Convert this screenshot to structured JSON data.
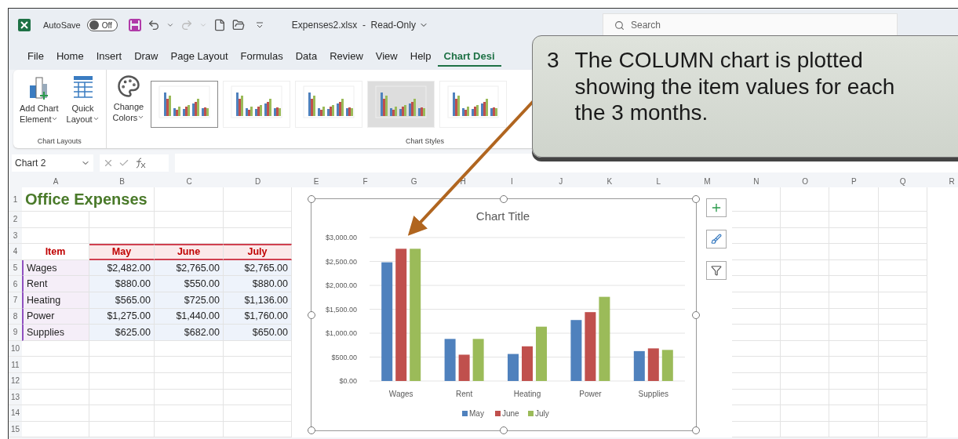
{
  "title_bar": {
    "autosave_label": "AutoSave",
    "autosave_toggle": {
      "on": false,
      "label": "Off"
    },
    "file_name": "Expenses2.xlsx  -  Read-Only",
    "search": {
      "placeholder": "Search"
    }
  },
  "menu_tabs": [
    {
      "label": "File",
      "selected": false
    },
    {
      "label": "Home",
      "selected": false
    },
    {
      "label": "Insert",
      "selected": false
    },
    {
      "label": "Draw",
      "selected": false
    },
    {
      "label": "Page Layout",
      "selected": false
    },
    {
      "label": "Formulas",
      "selected": false
    },
    {
      "label": "Data",
      "selected": false
    },
    {
      "label": "Review",
      "selected": false
    },
    {
      "label": "View",
      "selected": false
    },
    {
      "label": "Help",
      "selected": false
    },
    {
      "label": "Chart Desi",
      "selected": true
    }
  ],
  "ribbon": {
    "chart_layouts": {
      "label": "Chart Layouts",
      "buttons": [
        {
          "kind": "add",
          "lines": [
            "Add Chart",
            "Element"
          ]
        },
        {
          "kind": "layout",
          "lines": [
            "Quick",
            "Layout"
          ]
        }
      ]
    },
    "change_colors": {
      "lines": [
        "Change",
        "Colors"
      ]
    },
    "chart_styles": {
      "label": "Chart Styles",
      "styles": [
        {
          "selected": true
        },
        {
          "selected": false
        },
        {
          "selected": false
        },
        {
          "selected": false
        },
        {
          "selected": false
        }
      ]
    }
  },
  "formula_bar": {
    "name_box": "Chart 2"
  },
  "sheet": {
    "columns": [
      "A",
      "B",
      "C",
      "D",
      "E",
      "F",
      "G",
      "H",
      "I",
      "J",
      "K",
      "L",
      "M",
      "N",
      "O",
      "P",
      "Q",
      "R"
    ],
    "row_numbers": [
      "1",
      "2",
      "3",
      "4",
      "5",
      "6",
      "7",
      "8",
      "9",
      "10",
      "11",
      "12",
      "13",
      "14",
      "15"
    ],
    "title": "Office Expenses",
    "table": {
      "header": [
        "Item",
        "May",
        "June",
        "July"
      ],
      "rows": [
        [
          "Wages",
          "$2,482.00",
          "$2,765.00",
          "$2,765.00"
        ],
        [
          "Rent",
          "$880.00",
          "$550.00",
          "$880.00"
        ],
        [
          "Heating",
          "$565.00",
          "$725.00",
          "$1,136.00"
        ],
        [
          "Power",
          "$1,275.00",
          "$1,440.00",
          "$1,760.00"
        ],
        [
          "Supplies",
          "$625.00",
          "$682.00",
          "$650.00"
        ]
      ]
    },
    "chart": {
      "chart_data": {
        "type": "bar",
        "title": "Chart Title",
        "categories": [
          "Wages",
          "Rent",
          "Heating",
          "Power",
          "Supplies"
        ],
        "series": [
          {
            "name": "May",
            "color": "#4f81bd",
            "values": [
              2482,
              880,
              565,
              1275,
              625
            ]
          },
          {
            "name": "June",
            "color": "#c0504d",
            "values": [
              2765,
              550,
              725,
              1440,
              682
            ]
          },
          {
            "name": "July",
            "color": "#9bbb59",
            "values": [
              2765,
              880,
              1136,
              1760,
              650
            ]
          }
        ],
        "ylim": [
          0,
          3000
        ],
        "grid": true,
        "legend": true,
        "yticks": [
          {
            "value": 0,
            "label": "$0.00"
          },
          {
            "value": 500,
            "label": "$500.00"
          },
          {
            "value": 1000,
            "label": "$1,000.00"
          },
          {
            "value": 1500,
            "label": "$1,500.00"
          },
          {
            "value": 2000,
            "label": "$2,000.00"
          },
          {
            "value": 2500,
            "label": "$2,500.00"
          },
          {
            "value": 3000,
            "label": "$3,000.00"
          }
        ]
      }
    }
  },
  "callout": {
    "number": "3",
    "lines": [
      "The COLUMN chart is plotted",
      "showing the item values for each",
      "the 3 months."
    ]
  }
}
